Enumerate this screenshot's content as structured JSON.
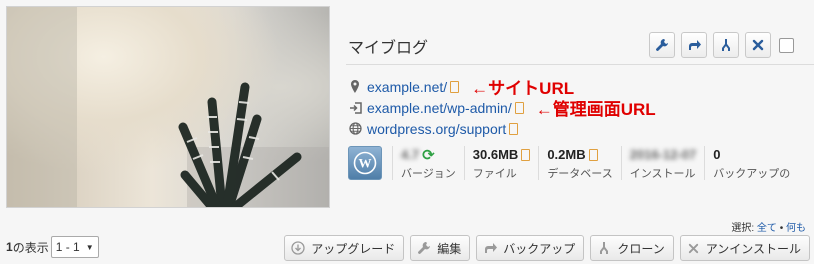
{
  "site": {
    "title": "マイブログ",
    "links": [
      {
        "icon": "map-pin-icon",
        "text": "example.net/"
      },
      {
        "icon": "login-icon",
        "text": "example.net/wp-admin/"
      },
      {
        "icon": "globe-icon",
        "text": "wordpress.org/support"
      }
    ],
    "annotations": {
      "site_url": "←サイトURL",
      "admin_url": "←管理画面URL"
    }
  },
  "stats": [
    {
      "value": "4.7",
      "label": "バージョン",
      "blurred": true
    },
    {
      "value": "30.6MB",
      "label": "ファイル",
      "blurred": false
    },
    {
      "value": "0.2MB",
      "label": "データベース",
      "blurred": false
    },
    {
      "value": "2016-12-07",
      "label": "インストール",
      "blurred": true
    },
    {
      "value": "0",
      "label": "バックアップの",
      "blurred": false
    }
  ],
  "selection": {
    "prefix": "選択:",
    "all": "全て",
    "separator": "•",
    "none": "何も"
  },
  "pagination": {
    "count_prefix": "1",
    "count_suffix": "の表示",
    "range": "1 - 1"
  },
  "buttons": {
    "upgrade": "アップグレード",
    "edit": "編集",
    "backup": "バックアップ",
    "clone": "クローン",
    "uninstall": "アンインストール"
  },
  "colors": {
    "link": "#1e5aa8",
    "annotation": "#e00000",
    "accent": "#1e5aa8"
  }
}
